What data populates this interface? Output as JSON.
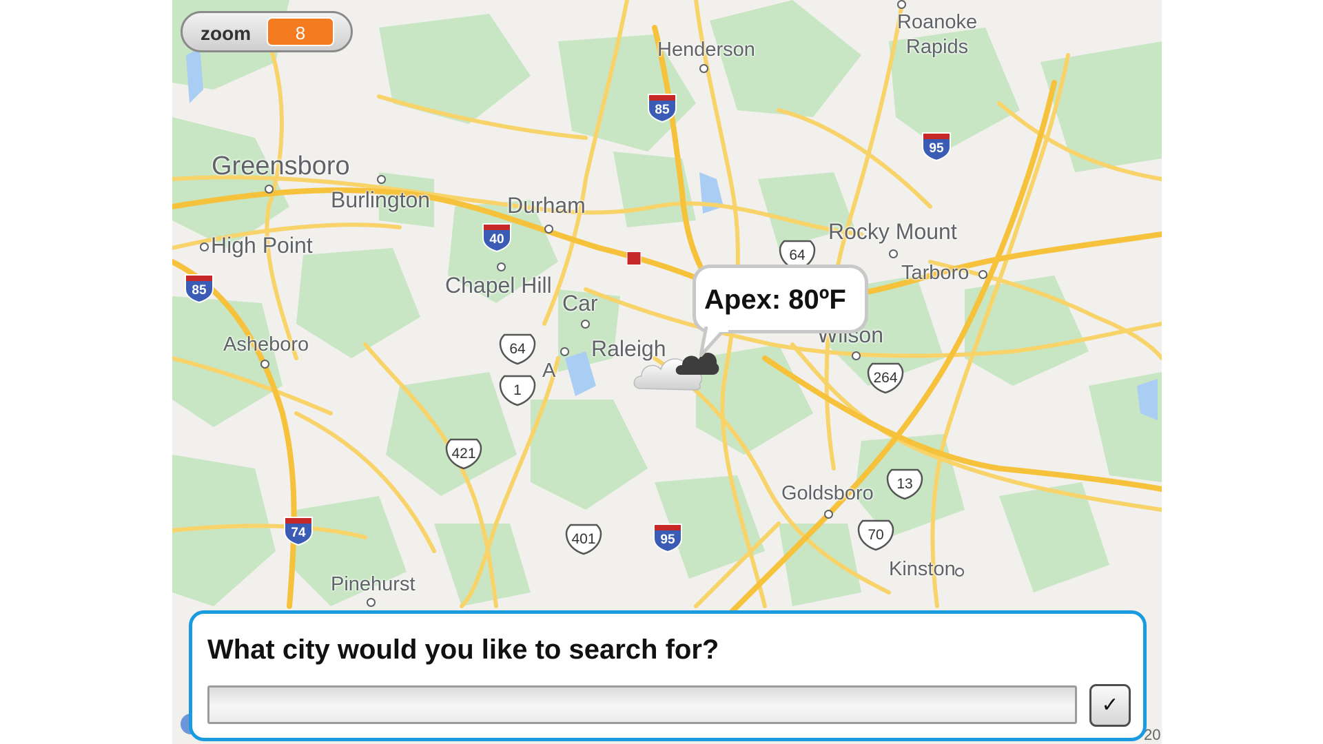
{
  "zoom": {
    "label": "zoom",
    "value": "8"
  },
  "weather": {
    "callout": "Apex: 80ºF",
    "icon": "partly-cloudy-icon"
  },
  "map": {
    "cities": {
      "roanoke_rapids": "Roanoke\nRapids",
      "henderson": "Henderson",
      "greensboro": "Greensboro",
      "burlington": "Burlington",
      "durham": "Durham",
      "high_point": "High Point",
      "chapel_hill": "Chapel Hill",
      "cary": "Car",
      "raleigh": "Raleigh",
      "apex": "A",
      "rocky_mount": "Rocky Mount",
      "tarboro": "Tarboro",
      "asheboro": "Asheboro",
      "wilson": "Wilson",
      "goldsboro": "Goldsboro",
      "kinston": "Kinston",
      "pinehurst": "Pinehurst"
    },
    "interstates": {
      "i85_north": "85",
      "i95_north": "95",
      "i40": "40",
      "i85_west": "85",
      "i74": "74",
      "i95_south": "95"
    },
    "us_routes": {
      "us64_east": "64",
      "us64_west": "64",
      "us1": "1",
      "us421": "421",
      "us264": "264",
      "us13": "13",
      "us401": "401",
      "us70": "70"
    },
    "colors": {
      "land": "#f1f0ec",
      "green": "#c8e6c4",
      "road": "#f8d36a",
      "water": "#a9cdf3",
      "interstate": "#3b5cb4"
    },
    "attribution": "20"
  },
  "search": {
    "question": "What city would you like to search for?",
    "input_value": "",
    "input_placeholder": "",
    "submit_label": "✓"
  },
  "accent_color": "#1a9be0"
}
